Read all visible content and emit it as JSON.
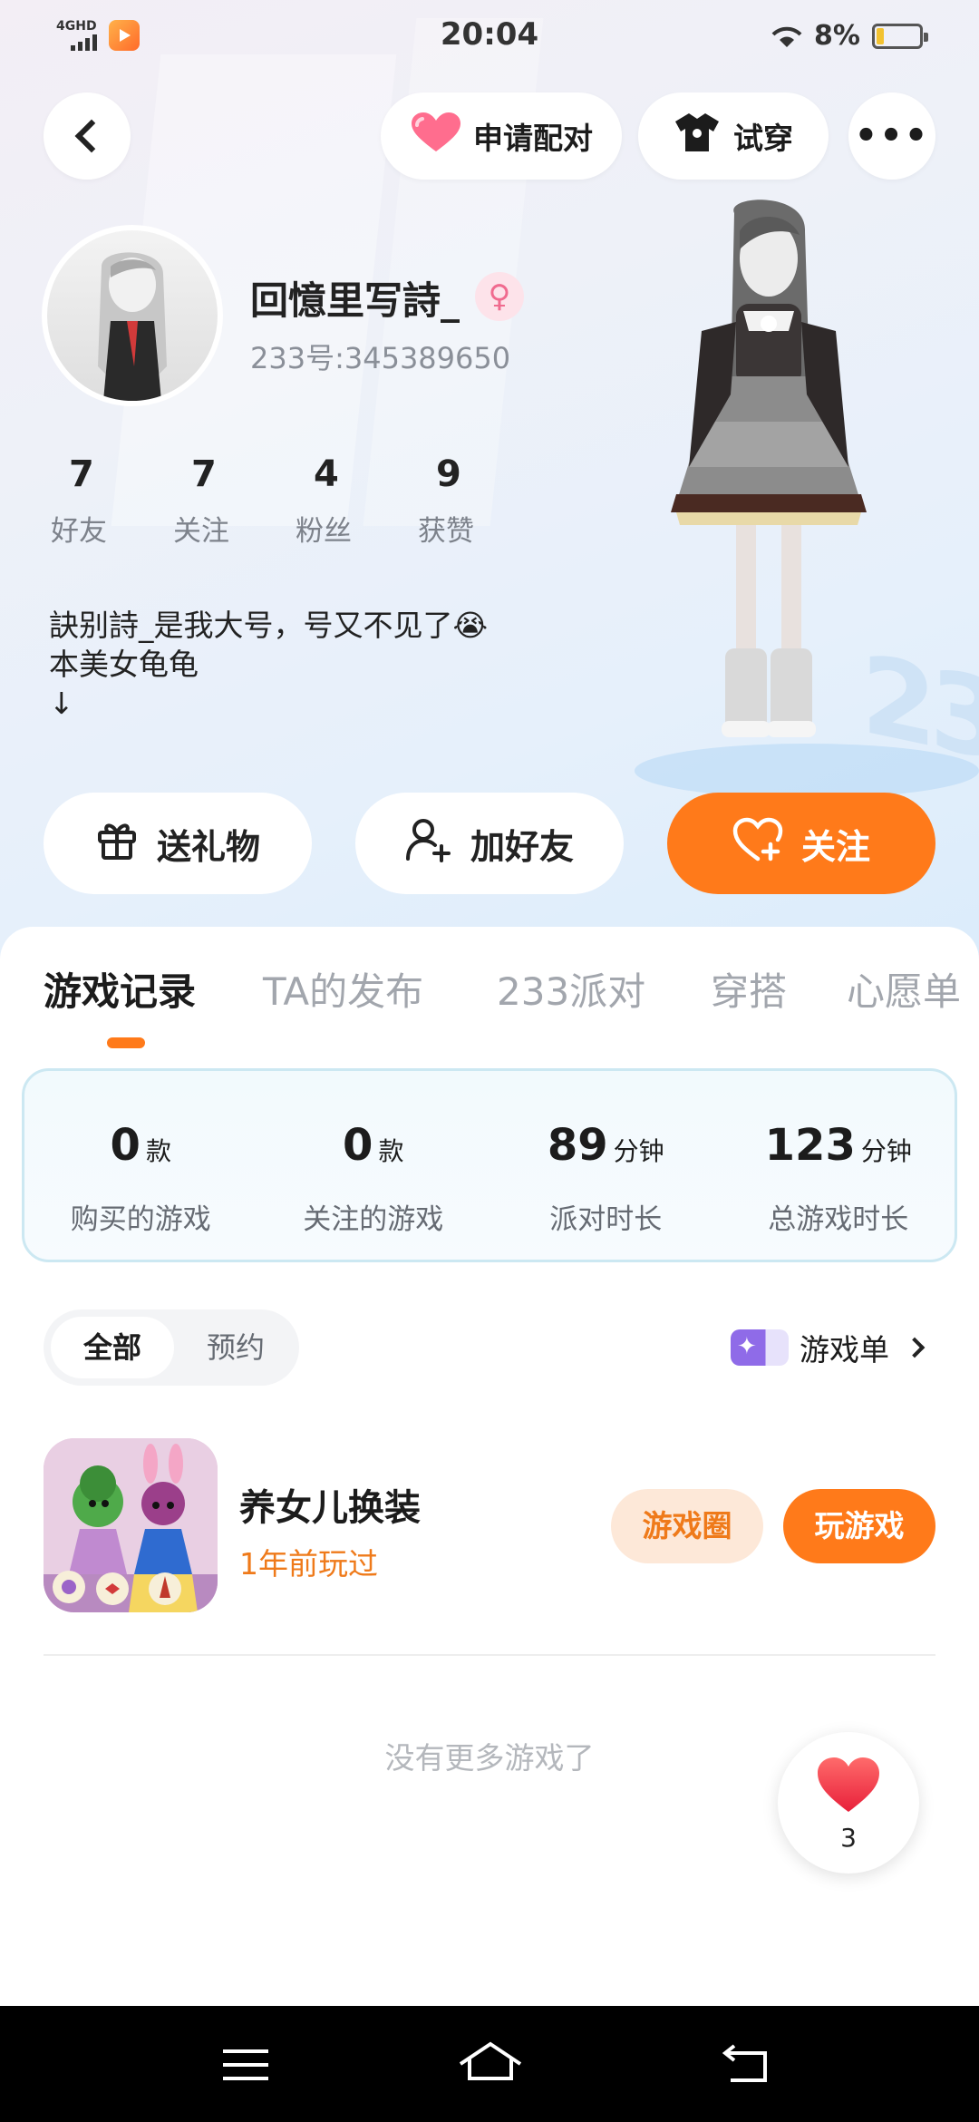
{
  "status_bar": {
    "time": "20:04",
    "network": "4GHD",
    "battery": "8%"
  },
  "header": {
    "pair_label": "申请配对",
    "try_on_label": "试穿",
    "more_label": "•••"
  },
  "profile": {
    "nickname": "回憶里写詩_",
    "gender_symbol": "♀",
    "uid": "233号:345389650",
    "stats": [
      {
        "value": "7",
        "label": "好友"
      },
      {
        "value": "7",
        "label": "关注"
      },
      {
        "value": "4",
        "label": "粉丝"
      },
      {
        "value": "9",
        "label": "获赞"
      }
    ],
    "bio": "訣别詩_是我大号，号又不见了😭\n本美女龟龟\n       ↓"
  },
  "actions": {
    "gift_label": "送礼物",
    "add_friend_label": "加好友",
    "follow_label": "关注"
  },
  "tabs": [
    {
      "label": "游戏记录",
      "active": true
    },
    {
      "label": "TA的发布",
      "active": false
    },
    {
      "label": "233派对",
      "active": false
    },
    {
      "label": "穿搭",
      "active": false
    },
    {
      "label": "心愿单",
      "active": false
    }
  ],
  "game_stats": [
    {
      "value": "0",
      "unit": "款",
      "label": "购买的游戏"
    },
    {
      "value": "0",
      "unit": "款",
      "label": "关注的游戏"
    },
    {
      "value": "89",
      "unit": "分钟",
      "label": "派对时长"
    },
    {
      "value": "123",
      "unit": "分钟",
      "label": "总游戏时长"
    }
  ],
  "filter": {
    "all_label": "全部",
    "reserve_label": "预约"
  },
  "game_list_link": "游戏单",
  "games": [
    {
      "title": "养女儿换装",
      "subtitle": "1年前玩过",
      "circle_label": "游戏圈",
      "play_label": "玩游戏"
    }
  ],
  "no_more_text": "没有更多游戏了",
  "like_count": "3",
  "colors": {
    "accent": "#ff7a1a",
    "accent_light": "#fde8d8",
    "card_border": "#cce8f2"
  },
  "icons": [
    "back-icon",
    "heart-icon",
    "shirt-icon",
    "more-icon",
    "gift-icon",
    "add-user-icon",
    "heart-plus-icon",
    "sparkle-icon",
    "chevron-right-icon",
    "menu-icon",
    "home-icon",
    "return-icon"
  ]
}
